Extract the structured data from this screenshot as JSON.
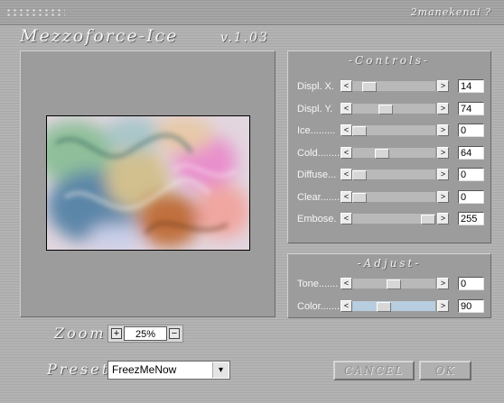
{
  "header": {
    "help_label": "?",
    "help_text": "2manekenai ?"
  },
  "app": {
    "title": "Mezzoforce-Ice",
    "version": "v.1.03"
  },
  "controls": {
    "title": "-Controls-",
    "rows": [
      {
        "label": "Displ. X.",
        "value": "14",
        "position": 0.15
      },
      {
        "label": "Displ. Y.",
        "value": "74",
        "position": 0.38
      },
      {
        "label": "Ice.........",
        "value": "0",
        "position": 0.0
      },
      {
        "label": "Cold........",
        "value": "64",
        "position": 0.33
      },
      {
        "label": "Diffuse...",
        "value": "0",
        "position": 0.0
      },
      {
        "label": "Clear.......",
        "value": "0",
        "position": 0.0
      },
      {
        "label": "Embose.",
        "value": "255",
        "position": 1.0
      }
    ]
  },
  "adjust": {
    "title": "-Adjust-",
    "rows": [
      {
        "label": "Tone.......",
        "value": "0",
        "position": 0.5
      },
      {
        "label": "Color.......",
        "value": "90",
        "position": 0.35
      }
    ]
  },
  "zoom": {
    "label": "Zoom",
    "value": "25%",
    "plus": "+",
    "minus": "−"
  },
  "preset": {
    "label": "Preset",
    "value": "FreezMeNow",
    "arrow": "▾"
  },
  "buttons": {
    "cancel": "CANCEL",
    "ok": "OK"
  },
  "slider_arrows": {
    "left": "<",
    "right": ">"
  },
  "colors": {
    "background": "#b0b0b0",
    "panel": "#9c9c9c",
    "text": "#f4f4f4",
    "color_track": "#b8cde0"
  }
}
